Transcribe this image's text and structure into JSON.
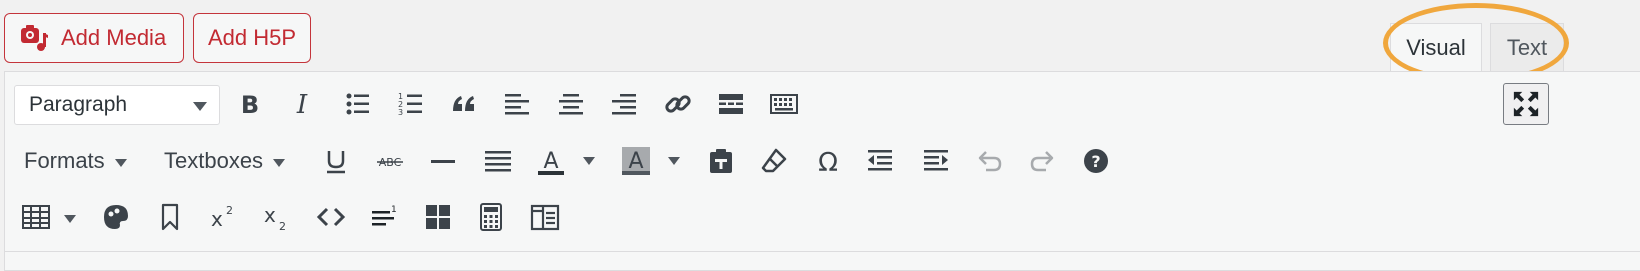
{
  "media_buttons": {
    "add_media": "Add Media",
    "add_h5p": "Add H5P"
  },
  "tabs": {
    "visual": "Visual",
    "text": "Text",
    "active": "visual"
  },
  "highlight_color": "#f0a73d",
  "accent_color": "#c22a32",
  "toolbar": {
    "format_select": {
      "value": "Paragraph"
    },
    "formats_menu": "Formats",
    "textboxes_menu": "Textboxes",
    "row1_icons": [
      "bold-icon",
      "italic-icon",
      "bullet-list-icon",
      "numbered-list-icon",
      "blockquote-icon",
      "align-left-icon",
      "align-center-icon",
      "align-right-icon",
      "link-icon",
      "read-more-icon",
      "toolbar-toggle-icon",
      "fullscreen-icon"
    ],
    "row2_icons": [
      "underline-icon",
      "strikethrough-icon",
      "horizontal-line-icon",
      "justify-icon",
      "text-color-icon",
      "background-color-icon",
      "paste-text-icon",
      "clear-formatting-icon",
      "special-character-icon",
      "outdent-icon",
      "indent-icon",
      "undo-icon",
      "redo-icon",
      "help-icon"
    ],
    "row3_icons": [
      "table-icon",
      "color-palette-icon",
      "bookmark-icon",
      "superscript-icon",
      "subscript-icon",
      "code-icon",
      "line-height-icon",
      "blocks-icon",
      "calculator-icon",
      "columns-icon"
    ]
  }
}
